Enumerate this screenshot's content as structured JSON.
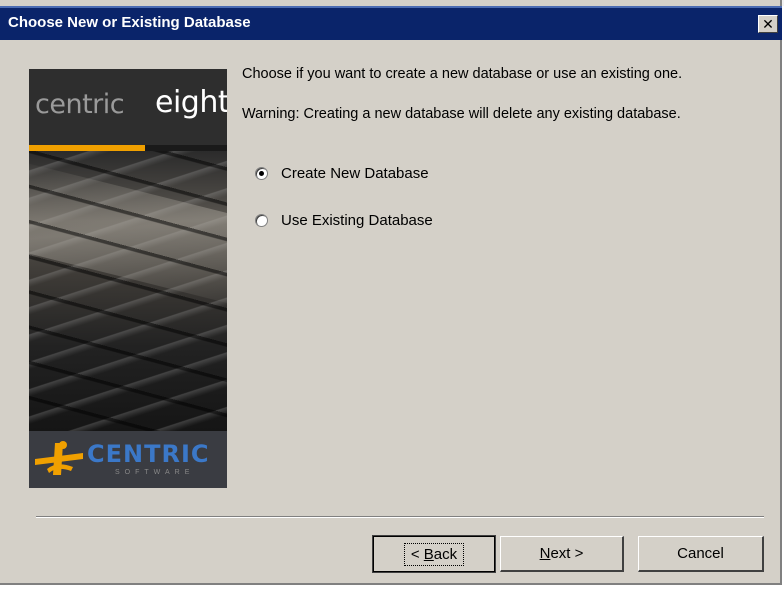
{
  "window": {
    "title": "Choose New or Existing Database",
    "close_glyph": "✕"
  },
  "banner": {
    "brand_word_a": "centric",
    "brand_word_b": "eight",
    "footer_word": "CENTRIC",
    "footer_sub": "SOFTWARE",
    "accent_color": "#f0a000",
    "footer_text_color": "#3b78c8"
  },
  "content": {
    "instruction": "Choose if you want to create a new database or use an existing one.",
    "warning": "Warning: Creating a new database will delete any existing database.",
    "options": [
      {
        "label": "Create New Database",
        "selected": true
      },
      {
        "label": "Use Existing Database",
        "selected": false
      }
    ]
  },
  "buttons": {
    "back_prefix": "< ",
    "back_mnemonic": "B",
    "back_rest": "ack",
    "next_mnemonic": "N",
    "next_rest": "ext >",
    "cancel_label": "Cancel"
  },
  "colors": {
    "titlebar": "#0a246a",
    "dialog_bg": "#d4d0c8"
  }
}
